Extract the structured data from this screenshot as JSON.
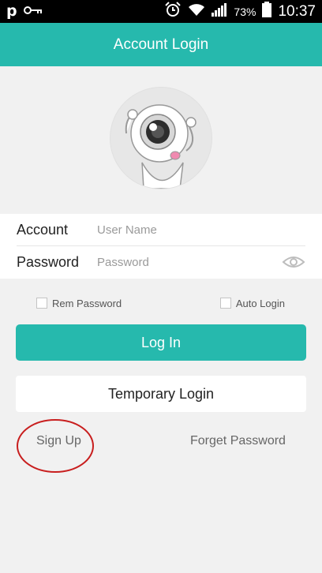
{
  "status_bar": {
    "left_letter": "p",
    "battery_percent": "73%",
    "time": "10:37"
  },
  "header": {
    "title": "Account Login"
  },
  "form": {
    "account_label": "Account",
    "account_placeholder": "User Name",
    "password_label": "Password",
    "password_placeholder": "Password"
  },
  "options": {
    "remember_label": "Rem Password",
    "auto_login_label": "Auto Login"
  },
  "buttons": {
    "login_label": "Log In",
    "temporary_login_label": "Temporary Login"
  },
  "links": {
    "sign_up": "Sign Up",
    "forget_password": "Forget Password"
  },
  "colors": {
    "accent": "#26b9ad",
    "annotation_circle": "#c81e1e"
  },
  "icons": {
    "status_left": [
      "p-notification-icon",
      "key-icon"
    ],
    "status_right": [
      "alarm-icon",
      "wifi-icon",
      "signal-icon",
      "battery-icon"
    ],
    "password_toggle": "eye-icon"
  }
}
